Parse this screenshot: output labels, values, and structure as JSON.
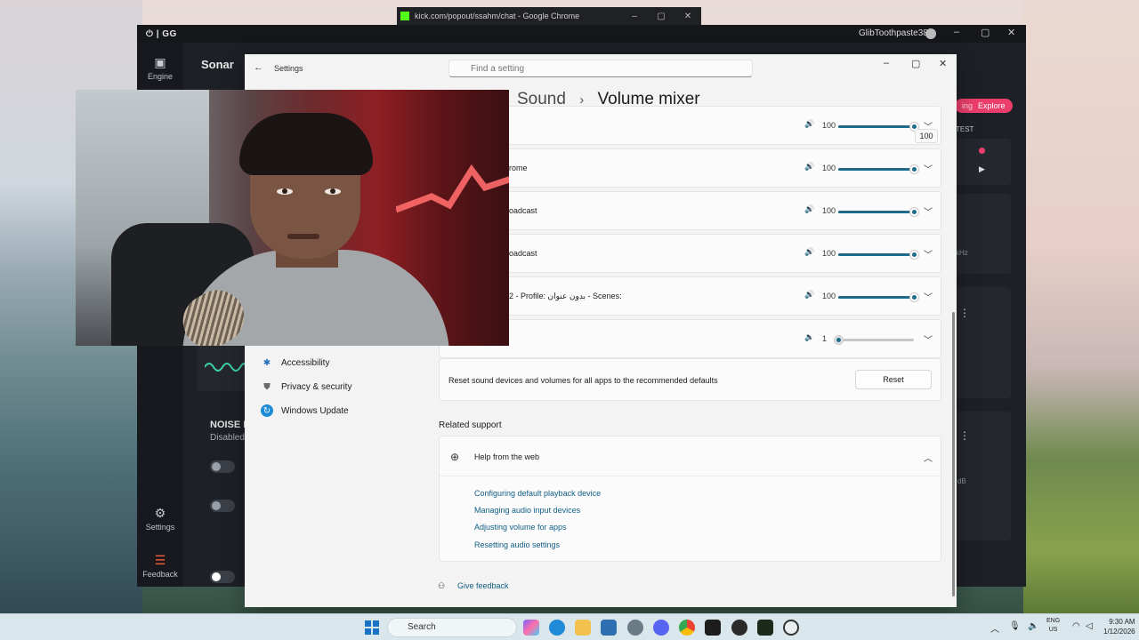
{
  "chrome_popout": {
    "title": "kick.com/popout/ssahm/chat - Google Chrome",
    "minimize": "–",
    "restore": "▢",
    "close": "✕"
  },
  "gg_app": {
    "logo": "⏻ | GG",
    "username": "GlibToothpaste38",
    "sidebar": {
      "engine": "Engine",
      "settings": "Settings",
      "feedback": "Feedback"
    },
    "section_title": "Sonar",
    "explore_label": "Explore",
    "explore_prefix": "ing",
    "test_label": "TEST",
    "khz_label": "kHz",
    "db_label": "dB",
    "noise_title": "NOISE R",
    "noise_status": "Disabled",
    "window_controls": {
      "minimize": "–",
      "restore": "▢",
      "close": "✕"
    }
  },
  "settings": {
    "app_title": "Settings",
    "search": {
      "placeholder": "Find a setting"
    },
    "window_controls": {
      "minimize": "–",
      "restore": "▢",
      "close": "✕"
    },
    "breadcrumb": {
      "parent": "Sound",
      "separator": "›",
      "current": "Volume mixer"
    },
    "nav_items": [
      {
        "label": "Accessibility",
        "icon": "accessibility-icon"
      },
      {
        "label": "Privacy & security",
        "icon": "shield-icon"
      },
      {
        "label": "Windows Update",
        "icon": "update-icon"
      }
    ],
    "apps": [
      {
        "name": "",
        "volume": "100",
        "level": 1.0
      },
      {
        "name": "rome",
        "volume": "100",
        "level": 1.0
      },
      {
        "name": "oadcast",
        "volume": "100",
        "level": 1.0
      },
      {
        "name": "oadcast",
        "volume": "100",
        "level": 1.0
      },
      {
        "name": "2 - Profile: بدون عنوان - Scenes:",
        "volume": "100",
        "level": 1.0
      },
      {
        "name": "",
        "volume": "1",
        "level": 0.0
      }
    ],
    "tooltip": "100",
    "reset": {
      "text": "Reset sound devices and volumes for all apps to the recommended defaults",
      "button": "Reset"
    },
    "related_support": "Related support",
    "help": {
      "title": "Help from the web",
      "links": [
        "Configuring default playback device",
        "Managing audio input devices",
        "Adjusting volume for apps",
        "Resetting audio settings"
      ]
    },
    "give_feedback": "Give feedback"
  },
  "taskbar": {
    "search_label": "Search",
    "lang_top": "ENG",
    "lang_bottom": "US",
    "time": "9:30 AM",
    "date": "1/12/2026",
    "accent": "#1a73c7"
  }
}
